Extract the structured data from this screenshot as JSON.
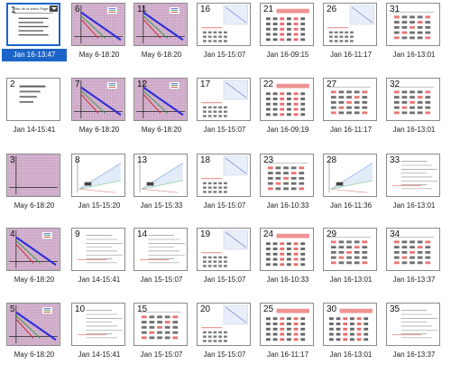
{
  "slides": [
    {
      "num": "1",
      "caption": "Jan 16-13:47",
      "type": "title",
      "selected": true,
      "title_text": "Title de la video Page Bar"
    },
    {
      "num": "2",
      "caption": "Jan 14-15:41",
      "type": "lines"
    },
    {
      "num": "3",
      "caption": "May 6-18:20",
      "type": "grid"
    },
    {
      "num": "4",
      "caption": "May 6-18:20",
      "type": "gridlines"
    },
    {
      "num": "5",
      "caption": "May 6-18:20",
      "type": "gridlines"
    },
    {
      "num": "6",
      "caption": "May 6-18:20",
      "type": "gridlines"
    },
    {
      "num": "7",
      "caption": "May 6-18:20",
      "type": "gridlines"
    },
    {
      "num": "8",
      "caption": "Jan 15-15:20",
      "type": "cone"
    },
    {
      "num": "9",
      "caption": "Jan 14-15:41",
      "type": "text"
    },
    {
      "num": "10",
      "caption": "Jan 14-15:41",
      "type": "text"
    },
    {
      "num": "11",
      "caption": "May 6-18:20",
      "type": "gridlines"
    },
    {
      "num": "12",
      "caption": "May 6-18:20",
      "type": "gridlines"
    },
    {
      "num": "13",
      "caption": "Jan 15-15:33",
      "type": "cone"
    },
    {
      "num": "14",
      "caption": "Jan 15-15:07",
      "type": "text"
    },
    {
      "num": "15",
      "caption": "Jan 15-15:07",
      "type": "table"
    },
    {
      "num": "16",
      "caption": "Jan 15-15:07",
      "type": "sketch"
    },
    {
      "num": "17",
      "caption": "Jan 15-15:07",
      "type": "sketch"
    },
    {
      "num": "18",
      "caption": "Jan 15-15:07",
      "type": "sketch"
    },
    {
      "num": "19",
      "caption": "Jan 15-15:07",
      "type": "sketch"
    },
    {
      "num": "20",
      "caption": "Jan 15-15:07",
      "type": "sketch"
    },
    {
      "num": "21",
      "caption": "Jan 16-09:15",
      "type": "redtable"
    },
    {
      "num": "22",
      "caption": "Jan 16-09:19",
      "type": "redtable"
    },
    {
      "num": "23",
      "caption": "Jan 16-10:33",
      "type": "table"
    },
    {
      "num": "24",
      "caption": "Jan 16-10:33",
      "type": "redtable"
    },
    {
      "num": "25",
      "caption": "Jan 16-11:17",
      "type": "redtable"
    },
    {
      "num": "26",
      "caption": "Jan 16-11:17",
      "type": "sketch"
    },
    {
      "num": "27",
      "caption": "Jan 16-11:17",
      "type": "table"
    },
    {
      "num": "28",
      "caption": "Jan 16-11:36",
      "type": "cone"
    },
    {
      "num": "29",
      "caption": "Jan 16-13:01",
      "type": "table"
    },
    {
      "num": "30",
      "caption": "Jan 16-13:01",
      "type": "redtable"
    },
    {
      "num": "31",
      "caption": "Jan 16-13:01",
      "type": "table"
    },
    {
      "num": "32",
      "caption": "Jan 16-13:01",
      "type": "table"
    },
    {
      "num": "33",
      "caption": "Jan 16-13:01",
      "type": "text"
    },
    {
      "num": "34",
      "caption": "Jan 16-13:37",
      "type": "table"
    },
    {
      "num": "35",
      "caption": "Jan 16-13:37",
      "type": "text"
    }
  ],
  "colors": {
    "selection": "#1c64c8",
    "grid_bg": "#c9a6c4",
    "line_blue": "#2d2dd8",
    "line_green": "#2a9a3a",
    "line_red": "#d22a2a",
    "table_red": "#e23a3a"
  }
}
